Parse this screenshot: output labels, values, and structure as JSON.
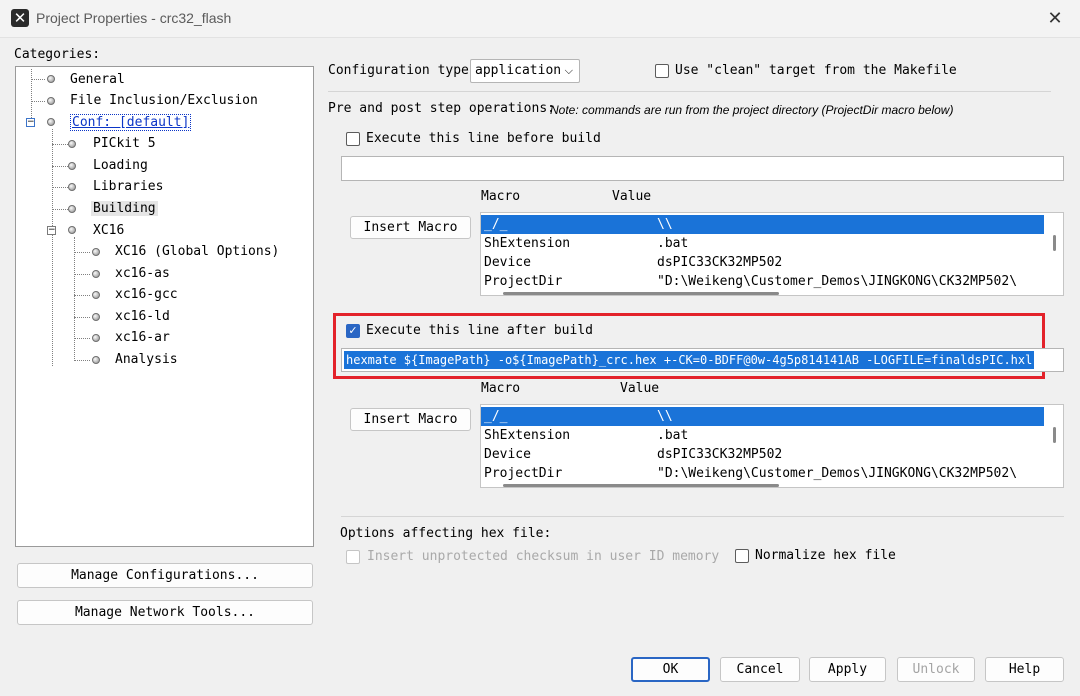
{
  "window": {
    "title": "Project Properties - crc32_flash",
    "close_glyph": "✕",
    "app_icon_glyph": "✕"
  },
  "categories": {
    "label": "Categories:",
    "items": [
      {
        "label": "General"
      },
      {
        "label": "File Inclusion/Exclusion"
      },
      {
        "label": "Conf: [default]"
      },
      {
        "label": "PICkit 5"
      },
      {
        "label": "Loading"
      },
      {
        "label": "Libraries"
      },
      {
        "label": "Building"
      },
      {
        "label": "XC16"
      },
      {
        "label": "XC16 (Global Options)"
      },
      {
        "label": "xc16-as"
      },
      {
        "label": "xc16-gcc"
      },
      {
        "label": "xc16-ld"
      },
      {
        "label": "xc16-ar"
      },
      {
        "label": "Analysis"
      }
    ],
    "expander_minus": "−"
  },
  "left_buttons": {
    "manage_configurations": "Manage Configurations...",
    "manage_network_tools": "Manage Network Tools..."
  },
  "config": {
    "type_label": "Configuration type:",
    "type_value": "application",
    "chevron": "⌵",
    "use_clean_label": "Use \"clean\" target from the Makefile",
    "use_clean_checked": false
  },
  "prepost": {
    "label": "Pre and post step operations:",
    "note": "Note: commands are run from the project directory (ProjectDir macro below)"
  },
  "before_build": {
    "checkbox_label": "Execute this line before build",
    "checked": false,
    "command": "",
    "macro_header": "Macro",
    "value_header": "Value",
    "insert_macro": "Insert Macro",
    "rows": [
      {
        "macro": "_/_",
        "value": "\\\\"
      },
      {
        "macro": "ShExtension",
        "value": ".bat"
      },
      {
        "macro": "Device",
        "value": "dsPIC33CK32MP502"
      },
      {
        "macro": "ProjectDir",
        "value": "\"D:\\Weikeng\\Customer_Demos\\JINGKONG\\CK32MP502\\"
      }
    ]
  },
  "after_build": {
    "checkbox_label": "Execute this line after build",
    "checked": true,
    "check_glyph": "✓",
    "command": "hexmate ${ImagePath} -o${ImagePath}_crc.hex +-CK=0-BDFF@0w-4g5p814141AB -LOGFILE=finaldsPIC.hxl",
    "macro_header": "Macro",
    "value_header": "Value",
    "insert_macro": "Insert Macro",
    "rows": [
      {
        "macro": "_/_",
        "value": "\\\\"
      },
      {
        "macro": "ShExtension",
        "value": ".bat"
      },
      {
        "macro": "Device",
        "value": "dsPIC33CK32MP502"
      },
      {
        "macro": "ProjectDir",
        "value": "\"D:\\Weikeng\\Customer_Demos\\JINGKONG\\CK32MP502\\"
      }
    ]
  },
  "hex_options": {
    "label": "Options affecting hex file:",
    "insert_checksum_label": "Insert unprotected checksum in user ID memory",
    "insert_checksum_checked": false,
    "normalize_label": "Normalize hex file",
    "normalize_checked": false
  },
  "footer": {
    "ok": "OK",
    "cancel": "Cancel",
    "apply": "Apply",
    "unlock": "Unlock",
    "help": "Help"
  },
  "colors": {
    "selection": "#1a73d8",
    "highlight_border": "#e3222a",
    "primary_border": "#2a66c4",
    "link": "#0b35c7"
  }
}
